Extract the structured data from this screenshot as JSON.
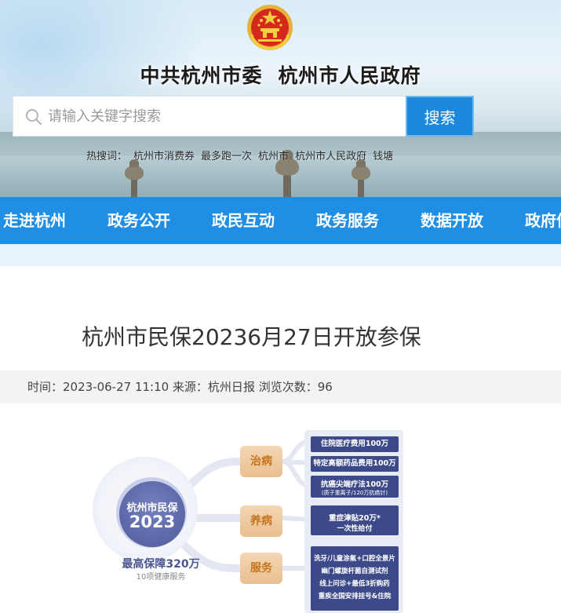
{
  "header": {
    "title_left": "中共杭州市委",
    "title_right": "杭州市人民政府"
  },
  "search": {
    "placeholder": "请输入关键字搜索",
    "button_label": "搜索"
  },
  "hot_words": [
    "热搜词：",
    "杭州市消费券",
    "最多跑一次",
    "杭州市",
    "杭州市人民政府",
    "钱塘"
  ],
  "nav": {
    "items": [
      "走进杭州",
      "政务公开",
      "政民互动",
      "政务服务",
      "数据开放",
      "政府信"
    ]
  },
  "article": {
    "title": "杭州市民保20236月27日开放参保",
    "meta": "时间：2023-06-27 11:10 来源：杭州日报 浏览次数：96"
  },
  "infographic": {
    "core_line1": "杭州市民保",
    "core_line2": "2023",
    "max_label": "最高保障320万",
    "sub_label": "10项健康服务",
    "categories": [
      "治病",
      "养病",
      "服务"
    ],
    "items": [
      {
        "text": "住院医疗费用100万",
        "small": ""
      },
      {
        "text": "特定高额药品费用100万",
        "small": ""
      },
      {
        "text": "抗癌尖端疗法100万",
        "small": "(质子重离子/120万抗癌针)"
      },
      {
        "text": "重症津贴20万*",
        "small": "一次性给付"
      }
    ],
    "service_items": [
      "洗牙/儿童涂氟+口腔全景片",
      "幽门螺旋杆菌自测试剂",
      "线上问诊+最低3折购药",
      "重疾全国安排挂号&住院"
    ]
  },
  "colors": {
    "nav_bg": "#1f8ee3",
    "search_button": "#1e88dc",
    "infographic_navy": "#3d4a8a",
    "category_orange": "#c5741b"
  }
}
